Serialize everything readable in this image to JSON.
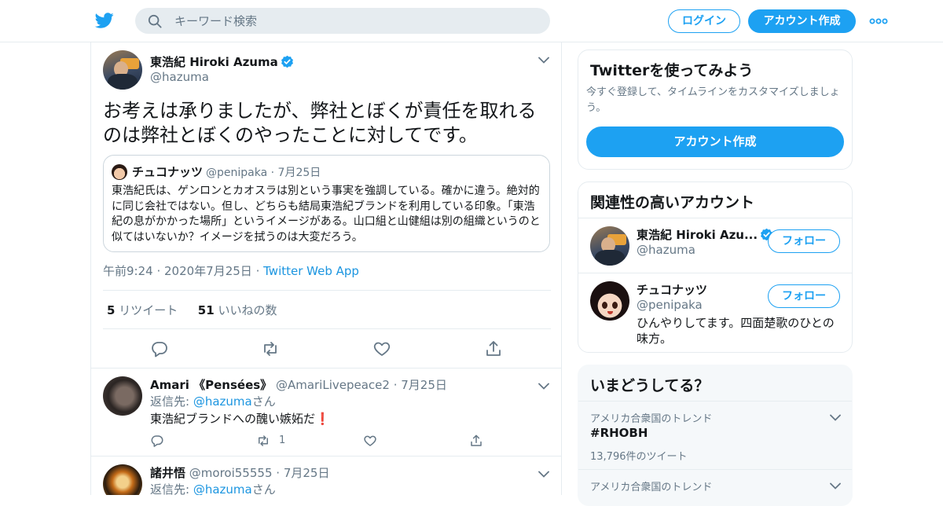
{
  "header": {
    "search_placeholder": "キーワード検索",
    "login_label": "ログイン",
    "signup_label": "アカウント作成"
  },
  "tweet": {
    "author_name": "東浩紀 Hiroki Azuma",
    "author_handle": "@hazuma",
    "text": "お考えは承りましたが、弊社とぼくが責任を取れるのは弊社とぼくのやったことに対してです。",
    "quote": {
      "author_name": "チュコナッツ",
      "author_handle": "@penipaka",
      "date": "7月25日",
      "text": "東浩紀氏は、ゲンロンとカオスラは別という事実を強調している。確かに違う。絶対的に同じ会社ではない。但し、どちらも結局東浩紀ブランドを利用している印象。「東浩紀の息がかかった場所」というイメージがある。山口組と山健組は別の組織というのと似てはいないか？イメージを拭うのは大変だろう。"
    },
    "time": "午前9:24",
    "date": "2020年7月25日",
    "source": "Twitter Web App",
    "retweet_count": "5",
    "retweet_label": "リツイート",
    "like_count": "51",
    "like_label": "いいねの数"
  },
  "replies": [
    {
      "author_name": "Amari 《Pensées》",
      "author_handle": "@AmariLivepeace2",
      "date": "7月25日",
      "reply_prefix": "返信先: ",
      "reply_to": "@hazuma",
      "reply_suffix": "さん",
      "text": "東浩紀ブランドへの醜い嫉妬だ",
      "emoji": "❗",
      "retweet_count": "1"
    },
    {
      "author_name": "諸井悟",
      "author_handle": "@moroi55555",
      "date": "7月25日",
      "reply_prefix": "返信先: ",
      "reply_to": "@hazuma",
      "reply_suffix": "さん"
    }
  ],
  "sidebar": {
    "signup_card": {
      "title": "Twitterを使ってみよう",
      "description": "今すぐ登録して、タイムラインをカスタマイズしましょう。",
      "button_label": "アカウント作成"
    },
    "related": {
      "title": "関連性の高いアカウント",
      "accounts": [
        {
          "name": "東浩紀 Hiroki Azu...",
          "handle": "@hazuma",
          "follow_label": "フォロー",
          "bio": ""
        },
        {
          "name": "チュコナッツ",
          "handle": "@penipaka",
          "follow_label": "フォロー",
          "bio": "ひんやりしてます。四面楚歌のひとの味方。"
        }
      ]
    },
    "trends": {
      "title": "いまどうしてる？",
      "items": [
        {
          "location": "アメリカ合衆国のトレンド",
          "name": "#RHOBH",
          "count": "13,796件のツイート"
        },
        {
          "location": "アメリカ合衆国のトレンド",
          "name": "",
          "count": ""
        }
      ]
    }
  },
  "colors": {
    "brand": "#1da1f2",
    "link": "#1b95e0",
    "text": "#14171a",
    "muted": "#657786",
    "border": "#e6ecf0"
  }
}
